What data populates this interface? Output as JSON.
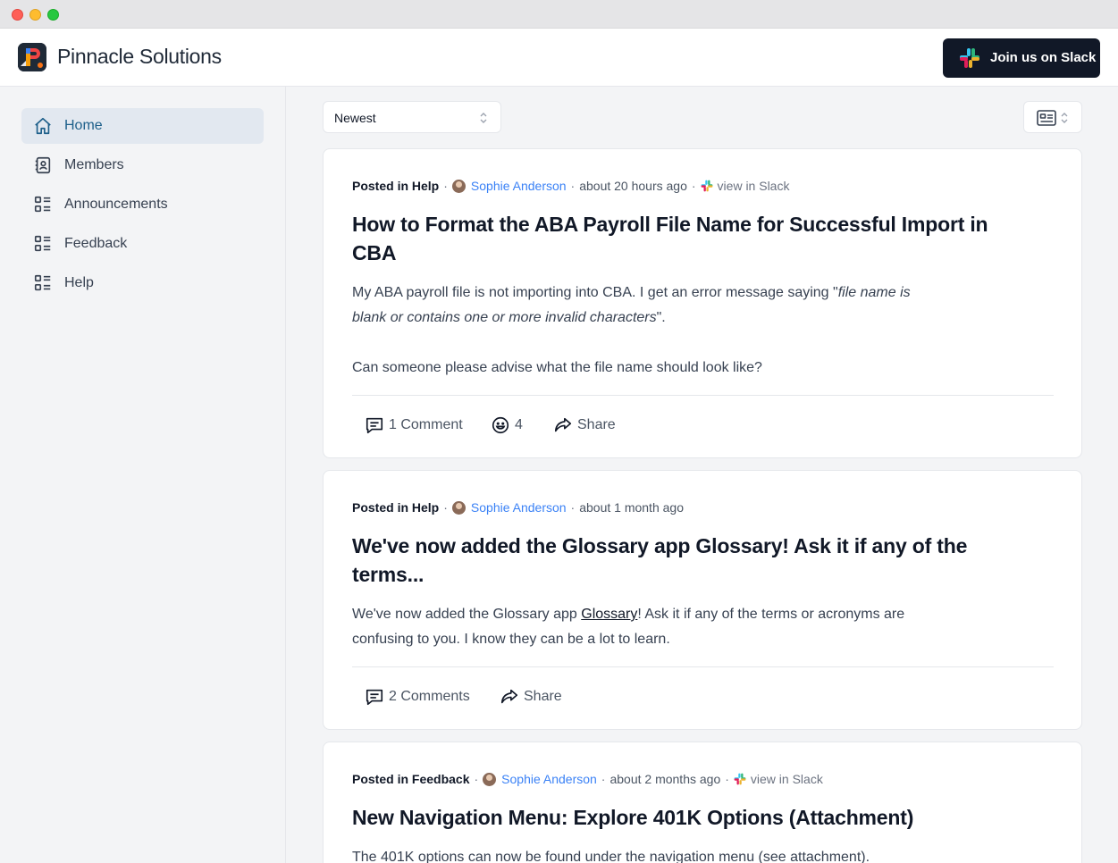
{
  "app": {
    "brand": "Pinnacle Solutions",
    "slack_button": "Join us on Slack",
    "logo_icon": "pinnacle-logo-icon"
  },
  "sidebar": {
    "items": [
      {
        "label": "Home",
        "icon": "home-icon",
        "active": true
      },
      {
        "label": "Members",
        "icon": "contacts-icon",
        "active": false
      },
      {
        "label": "Announcements",
        "icon": "list-icon",
        "active": false
      },
      {
        "label": "Feedback",
        "icon": "list-icon",
        "active": false
      },
      {
        "label": "Help",
        "icon": "list-icon",
        "active": false
      }
    ]
  },
  "toolbar": {
    "sort_value": "Newest",
    "view_icon": "card-view-icon"
  },
  "colors": {
    "accent": "#1d5f8a",
    "author_link": "#3b82f6",
    "dark_button": "#111827"
  },
  "posts": [
    {
      "posted_prefix": "Posted in Help",
      "author": "Sophie Anderson",
      "time": "about 20 hours ago",
      "view_in_slack": "view in Slack",
      "title": "How to Format the ABA Payroll File Name for Successful Import in CBA",
      "body_p1_start": "My ABA payroll file is not importing into CBA. I get an error message saying \"",
      "body_p1_italic": "file name is blank or contains one or more invalid characters",
      "body_p1_end": "\".",
      "body_p2": "Can someone please advise what the file name should look like?",
      "comments": "1 Comment",
      "reactions": "4",
      "share": "Share"
    },
    {
      "posted_prefix": "Posted in Help",
      "author": "Sophie Anderson",
      "time": "about 1 month ago",
      "title": "We've now added the Glossary app Glossary! Ask it if any of the terms...",
      "body_start": "We've now added the Glossary app ",
      "body_link": "Glossary",
      "body_end": "! Ask it if any of the terms or acronyms are confusing to you. I know they can be a lot to learn.",
      "comments": "2 Comments",
      "share": "Share"
    },
    {
      "posted_prefix": "Posted in Feedback",
      "author": "Sophie Anderson",
      "time": "about 2 months ago",
      "view_in_slack": "view in Slack",
      "title": "New Navigation Menu: Explore 401K Options (Attachment)",
      "body": "The 401K options can now be found under the navigation menu (see attachment)."
    }
  ]
}
